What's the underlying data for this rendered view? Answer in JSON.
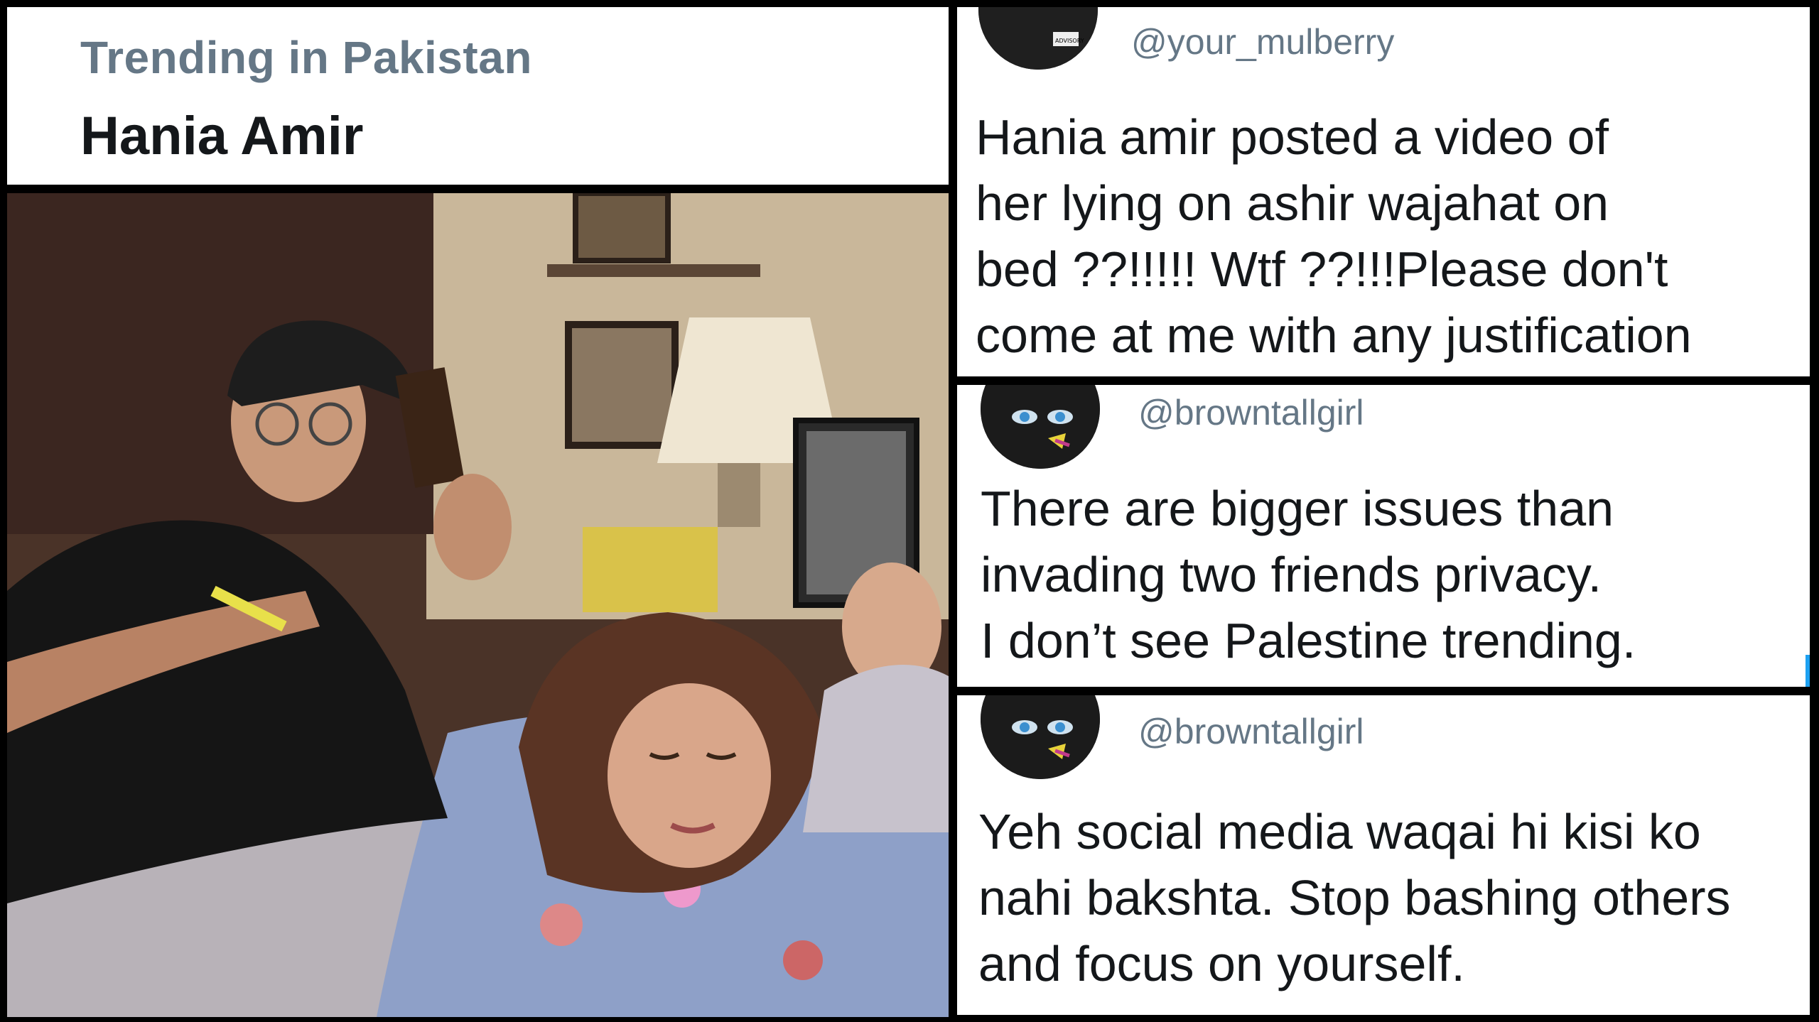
{
  "trending": {
    "label": "Trending in Pakistan",
    "topic": "Hania Amir"
  },
  "photo": {
    "icon": "photo-of-two-people-on-bed"
  },
  "tweets": [
    {
      "handle": "@your_mulberry",
      "text": "Hania amir posted a video of\nher lying on ashir wajahat on\nbed ??!!!!! Wtf ??!!!Please don't\ncome at me with any justification"
    },
    {
      "handle": "@browntallgirl",
      "text": "There are bigger issues than\ninvading two friends privacy.\nI don’t see Palestine trending."
    },
    {
      "handle": "@browntallgirl",
      "text": "Yeh social media waqai hi kisi ko\nnahi bakshta. Stop bashing others\nand focus on yourself."
    }
  ],
  "colors": {
    "background": "#000000",
    "panel": "#ffffff",
    "secondary_text": "#657786",
    "primary_text": "#14171a"
  }
}
